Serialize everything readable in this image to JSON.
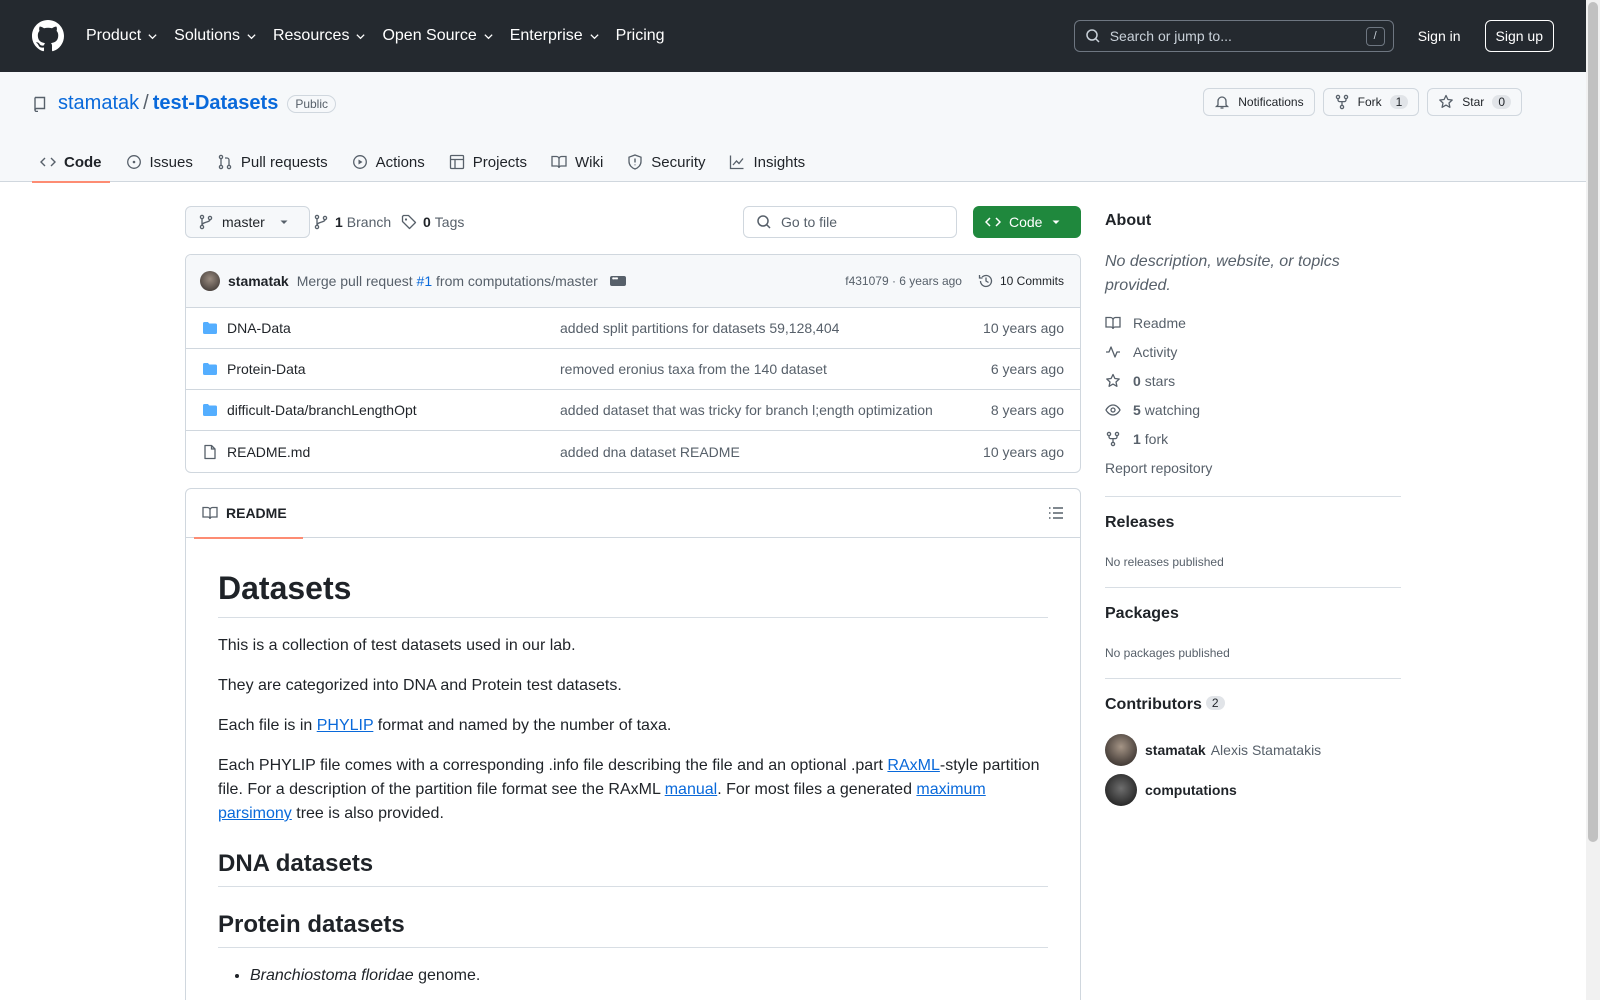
{
  "header": {
    "nav": [
      "Product",
      "Solutions",
      "Resources",
      "Open Source",
      "Enterprise",
      "Pricing"
    ],
    "search_placeholder": "Search or jump to...",
    "search_shortcut": "/",
    "sign_in": "Sign in",
    "sign_up": "Sign up"
  },
  "repo": {
    "owner": "stamatak",
    "separator": "/",
    "name": "test-Datasets",
    "visibility": "Public",
    "notifications_label": "Notifications",
    "fork_label": "Fork",
    "fork_count": "1",
    "star_label": "Star",
    "star_count": "0"
  },
  "tabs": [
    "Code",
    "Issues",
    "Pull requests",
    "Actions",
    "Projects",
    "Wiki",
    "Security",
    "Insights"
  ],
  "toolbar": {
    "branch": "master",
    "branch_count": "1",
    "branch_label": "Branch",
    "tag_count": "0",
    "tag_label": "Tags",
    "goto_placeholder": "Go to file",
    "code_label": "Code"
  },
  "commit": {
    "author": "stamatak",
    "message_pre": "Merge pull request ",
    "pr": "#1",
    "message_post": " from computations/master",
    "hash_time": "f431079 · 6 years ago",
    "commits_label": "10 Commits"
  },
  "files": [
    {
      "type": "folder",
      "name": "DNA-Data",
      "message": "added split partitions for datasets 59,128,404",
      "date": "10 years ago"
    },
    {
      "type": "folder",
      "name": "Protein-Data",
      "message": "removed eronius taxa from the 140 dataset",
      "date": "6 years ago"
    },
    {
      "type": "folder",
      "name": "difficult-Data/branchLengthOpt",
      "message": "added dataset that was tricky for branch l;ength optimization",
      "date": "8 years ago"
    },
    {
      "type": "file",
      "name": "README.md",
      "message": "added dna dataset README",
      "date": "10 years ago"
    }
  ],
  "readme": {
    "tab_label": "README",
    "h1": "Datasets",
    "p1": "This is a collection of test datasets used in our lab.",
    "p2": "They are categorized into DNA and Protein test datasets.",
    "p3_pre": "Each file is in ",
    "p3_link": "PHYLIP",
    "p3_post": " format and named by the number of taxa.",
    "p4_a": "Each PHYLIP file comes with a corresponding .info file describing the file and an optional .part ",
    "p4_link1": "RAxML",
    "p4_b": "-style partition file. For a description of the partition file format see the RAxML ",
    "p4_link2": "manual",
    "p4_c": ". For most files a generated ",
    "p4_link3": "maximum parsimony",
    "p4_d": " tree is also provided.",
    "h2_dna": "DNA datasets",
    "h2_protein": "Protein datasets",
    "li1_italic": "Branchiostoma floridae",
    "li1_rest": " genome."
  },
  "sidebar": {
    "about_title": "About",
    "about_desc": "No description, website, or topics provided.",
    "readme": "Readme",
    "activity": "Activity",
    "stars_count": "0",
    "stars_label": "stars",
    "watching_count": "5",
    "watching_label": "watching",
    "fork_count": "1",
    "fork_label": "fork",
    "report": "Report repository",
    "releases_title": "Releases",
    "releases_sub": "No releases published",
    "packages_title": "Packages",
    "packages_sub": "No packages published",
    "contributors_title": "Contributors",
    "contributors_count": "2",
    "contributors": [
      {
        "login": "stamatak",
        "full": "Alexis Stamatakis"
      },
      {
        "login": "computations",
        "full": ""
      }
    ]
  },
  "colors": {
    "header_bg": "#24292f",
    "accent_blue": "#0969da",
    "code_green": "#1f883d",
    "tab_underline": "#fd8c73"
  }
}
